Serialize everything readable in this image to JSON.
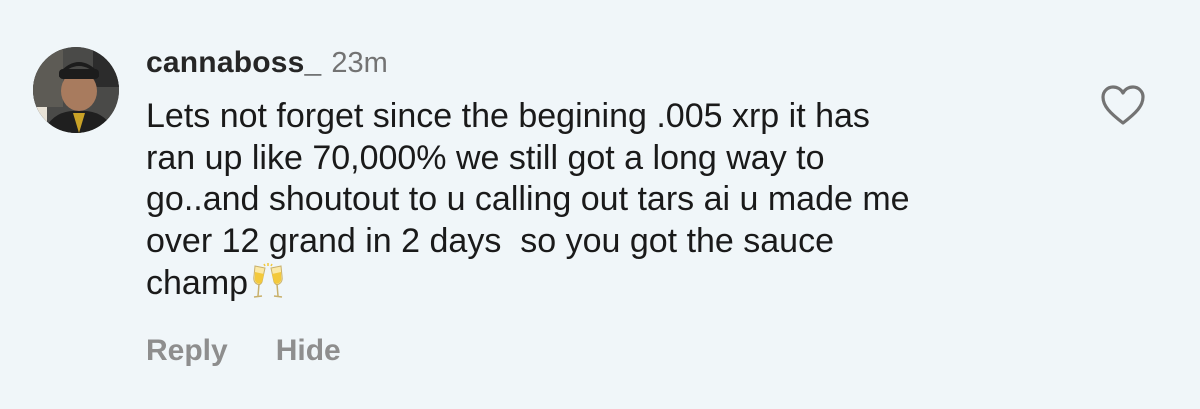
{
  "comment": {
    "username": "cannaboss_",
    "timestamp": "23m",
    "text_lines": [
      "Lets not forget since the begining .005 xrp it has",
      "ran up like 70,000% we still got a long way to",
      "go..and shoutout to u calling out tars ai u made me",
      "over 12 grand in 2 days  so you got the sauce",
      "champ"
    ],
    "emoji": "clinking-glasses",
    "avatar_icon": "profile-photo",
    "like_icon": "heart-outline-icon"
  },
  "actions": {
    "reply_label": "Reply",
    "hide_label": "Hide"
  },
  "colors": {
    "background": "#f0f6f9",
    "username": "#262626",
    "muted": "#737373",
    "action": "#8e8e8e"
  }
}
